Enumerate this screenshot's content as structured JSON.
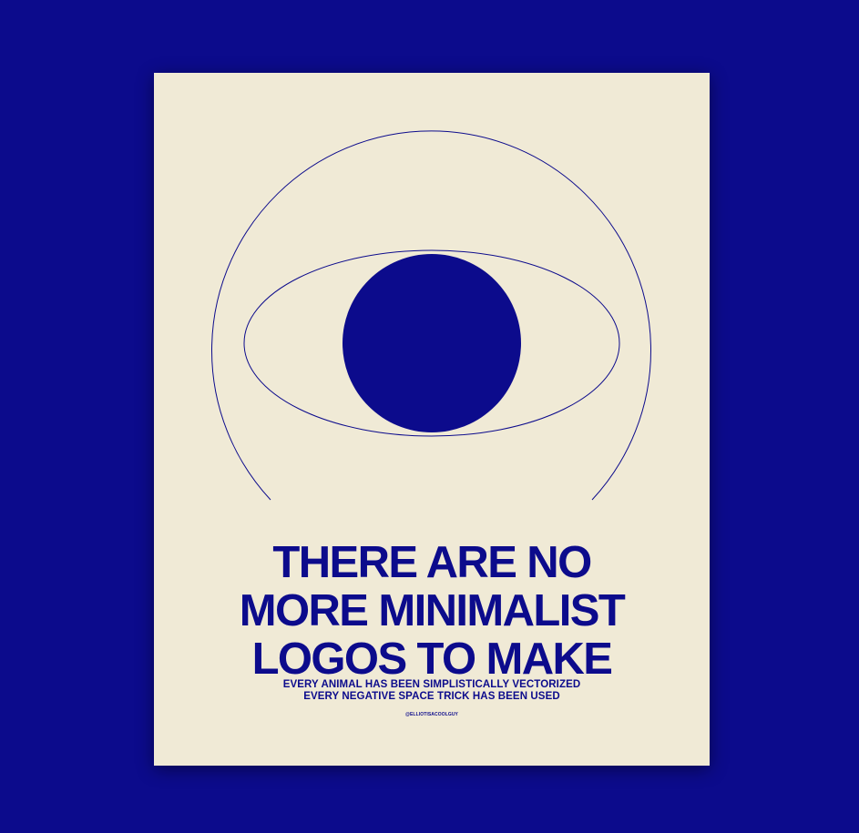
{
  "poster": {
    "headline_lines": [
      "THERE ARE NO",
      "MORE MINIMALIST",
      "LOGOS TO MAKE"
    ],
    "subtext_lines": [
      "EVERY ANIMAL HAS BEEN SIMPLISTICALLY VECTORIZED",
      "EVERY NEGATIVE SPACE TRICK HAS BEEN USED"
    ],
    "handle": "@ELLIOTISACOOLGUY",
    "colors": {
      "background": "#0c0b8c",
      "paper": "#f0ead6",
      "ink": "#0c0b8c"
    },
    "illustration": "eye-icon"
  }
}
